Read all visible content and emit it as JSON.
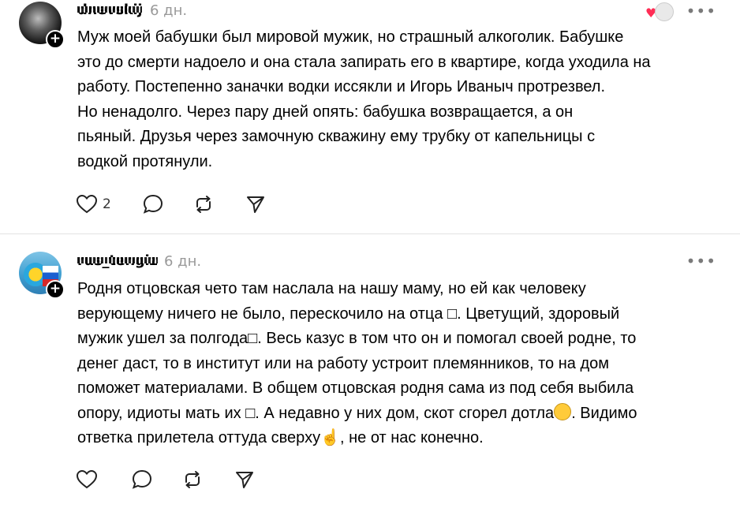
{
  "posts": [
    {
      "username": "dnevskij",
      "timestamp": "6 дн.",
      "text": "Муж моей бабушки был мировой мужик, но страшный алкоголик. Бабушке\nэто до смерти надоело и она стала запирать его в квартире, когда уходила на\nработу. Постепенно заначки водки иссякли и Игорь Иваныч протрезвел.\nНо ненадолго. Через пару дней опять: бабушка возвращается, а он\nпьяный. Друзья через замочную скважину ему трубку от капельницы с\nводкой протянули.",
      "like_count": "2",
      "more": "•••",
      "plus": "+"
    },
    {
      "username": "rus_tengiz",
      "timestamp": "6 дн.",
      "text_parts": [
        "Родня отцовская чето там наслала на нашу маму, но ей как человеку\nверующему ничего не было, перескочило на отца ",
        "□",
        ". Цветущий, здоровый\nмужик ушел за полгода",
        "□",
        ". Весь казус в том что он и помогал своей родне, то\nденег даст, то в институт или на работу устроит племянников, то на дом\nпоможет материалами. В общем отцовская родня сама из под себя выбила\nопору, идиоты мать их ",
        "□",
        ". А недавно у них дом, скот сгорел дотла",
        ". Видимо\nответка прилетела оттуда сверху",
        ", не от нас конечно."
      ],
      "more": "•••",
      "plus": "+",
      "emoji_point": "☝"
    }
  ],
  "icons": {
    "like": "heart-outline-icon",
    "comment": "comment-bubble-icon",
    "repost": "repost-arrows-icon",
    "share": "send-paper-plane-icon"
  },
  "colors": {
    "timestamp": "#999999",
    "divider": "#e2e2e2",
    "reaction_heart": "#ff2d55"
  }
}
